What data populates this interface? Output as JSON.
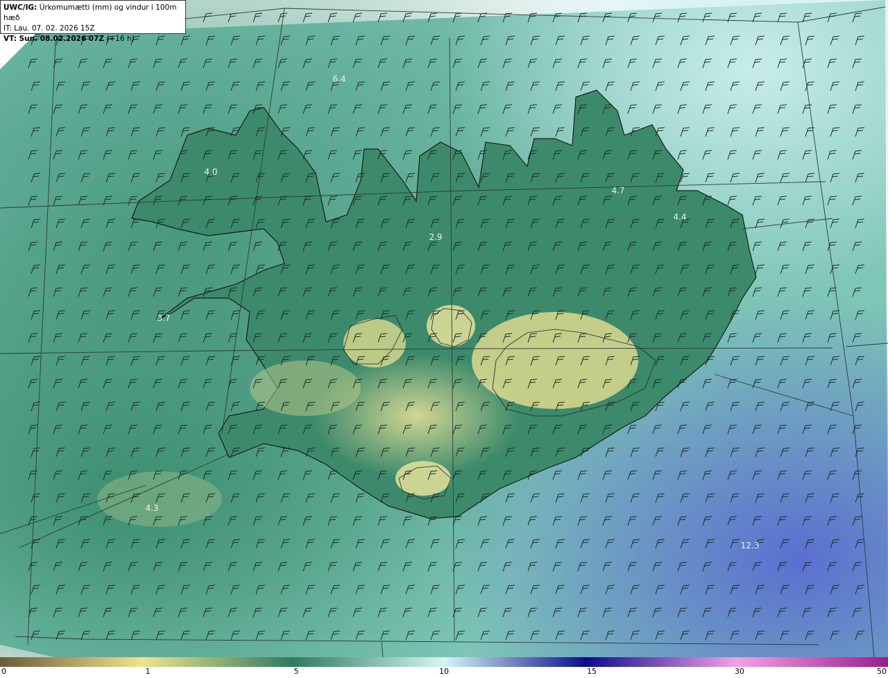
{
  "header": {
    "model": "UWC/IG:",
    "title": "Úrkomumætti (mm) og vindur i 100m hæð",
    "init_time": "IT: Lau. 07. 02. 2026 15Z",
    "valid_label": "VT: Sun. 08.02.2026 07Z",
    "lead": "(+16 h)"
  },
  "map_values": [
    {
      "text": "6.4",
      "pos": "north-sea"
    },
    {
      "text": "4.0",
      "pos": "westfjords"
    },
    {
      "text": "2.9",
      "pos": "north-central"
    },
    {
      "text": "4.7",
      "pos": "north-east"
    },
    {
      "text": "4.4",
      "pos": "east"
    },
    {
      "text": "3.7",
      "pos": "west"
    },
    {
      "text": "4.3",
      "pos": "south-west-sea"
    },
    {
      "text": "12.3",
      "pos": "south-east-sea"
    }
  ],
  "colorbar": {
    "ticks": [
      "0",
      "1",
      "5",
      "10",
      "15",
      "30",
      "50"
    ],
    "stops": [
      {
        "frac": 0.0,
        "color": "#6e5a3c"
      },
      {
        "frac": 0.16,
        "color": "#f0e48c"
      },
      {
        "frac": 0.33,
        "color": "#2f7a5e"
      },
      {
        "frac": 0.5,
        "color": "#d4f6f4"
      },
      {
        "frac": 0.66,
        "color": "#0c0c8c"
      },
      {
        "frac": 0.83,
        "color": "#f2a2e6"
      },
      {
        "frac": 1.0,
        "color": "#9c1c8c"
      }
    ]
  },
  "colors": {
    "sea_light": "#9fd8d0",
    "sea_teal": "#5fae9a",
    "land_green": "#3f8e6e",
    "land_yellow": "#d8da8c",
    "sea_blue": "#6f7fd0",
    "coast": "#1a1a1a",
    "barb": "#1e2a28"
  }
}
